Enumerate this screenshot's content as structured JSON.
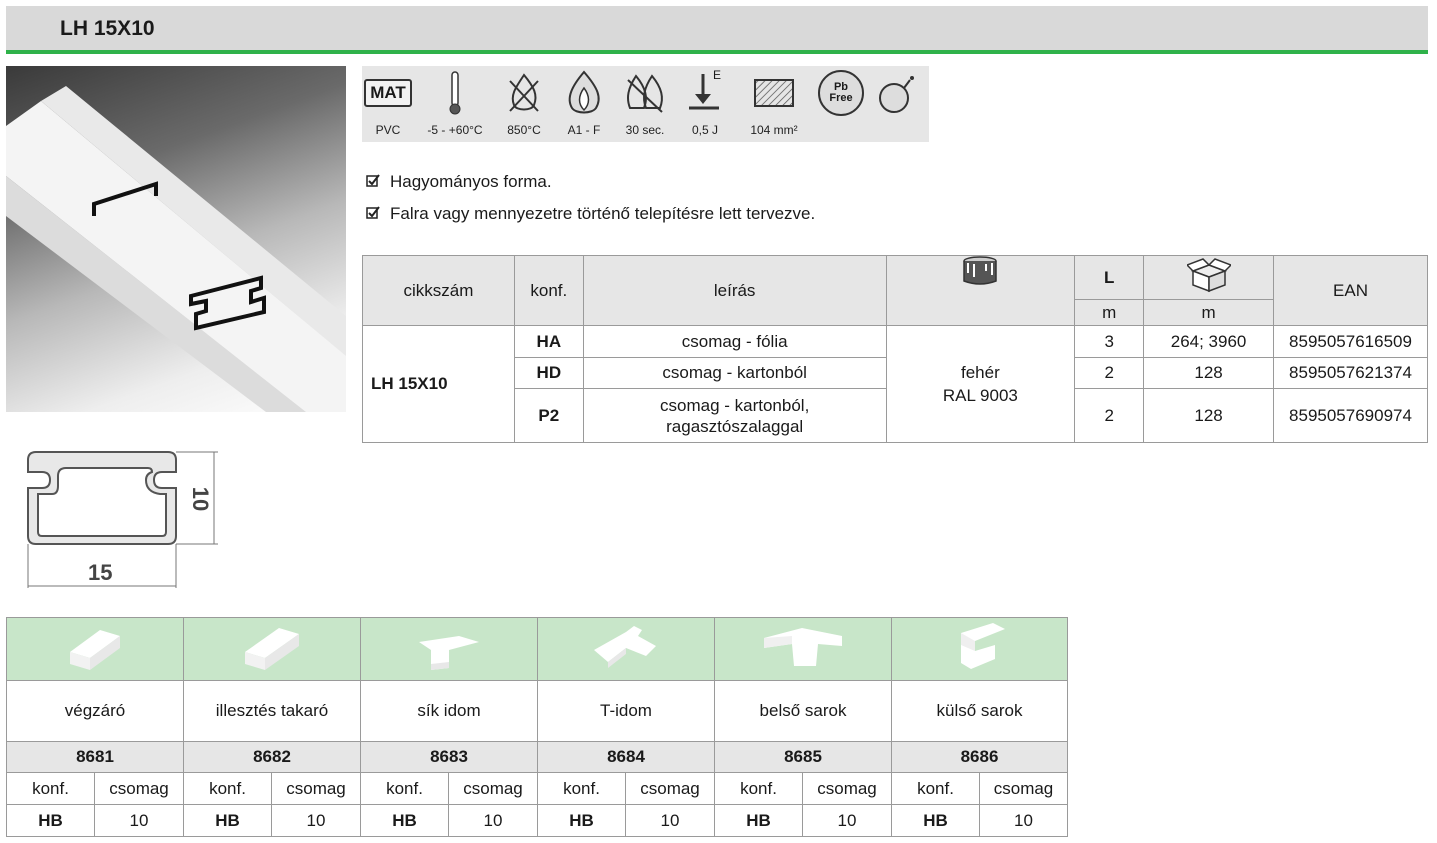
{
  "header": {
    "title": "LH 15X10"
  },
  "profile_drawing": {
    "width_label": "15",
    "height_label": "10"
  },
  "icons": [
    {
      "icon": "mat-box-icon",
      "label": "PVC",
      "badge": "MAT"
    },
    {
      "icon": "thermometer-icon",
      "label": "-5 - +60°C"
    },
    {
      "icon": "crossed-flame-icon",
      "label": "850°C"
    },
    {
      "icon": "flame-icon",
      "label": "A1 - F"
    },
    {
      "icon": "double-flame-icon",
      "label": "30 sec."
    },
    {
      "icon": "impact-arrow-icon",
      "label": "0,5 J",
      "badge": "E"
    },
    {
      "icon": "cross-section-icon",
      "label": "104 mm²"
    },
    {
      "icon": "pb-free-icon",
      "label": "",
      "badge_top": "Pb",
      "badge_bottom": "Free"
    },
    {
      "icon": "bomb-icon",
      "label": ""
    }
  ],
  "features": [
    "Hagyományos forma.",
    "Falra vagy mennyezetre történő telepítésre lett tervezve."
  ],
  "spec_table": {
    "headers": {
      "code": "cikkszám",
      "conf": "konf.",
      "desc": "leírás",
      "color_icon": "paint-bucket-icon",
      "length": "L",
      "length_unit": "m",
      "package_icon": "box-icon",
      "package_unit": "m",
      "ean": "EAN"
    },
    "product": "LH 15X10",
    "color": {
      "line1": "fehér",
      "line2": "RAL 9003"
    },
    "rows": [
      {
        "conf": "HA",
        "desc": "csomag - fólia",
        "desc2": "",
        "length": "3",
        "package": "264; 3960",
        "ean": "8595057616509"
      },
      {
        "conf": "HD",
        "desc": "csomag - kartonból",
        "desc2": "",
        "length": "2",
        "package": "128",
        "ean": "8595057621374"
      },
      {
        "conf": "P2",
        "desc": "csomag - kartonból,",
        "desc2": "ragasztószalaggal",
        "length": "2",
        "package": "128",
        "ean": "8595057690974"
      }
    ]
  },
  "accessories": {
    "sub_headers": {
      "conf": "konf.",
      "pack": "csomag"
    },
    "items": [
      {
        "name": "végzáró",
        "code": "8681",
        "conf": "HB",
        "pack": "10",
        "icon": "end-cap-icon"
      },
      {
        "name": "illesztés takaró",
        "code": "8682",
        "conf": "HB",
        "pack": "10",
        "icon": "joint-cover-icon"
      },
      {
        "name": "sík idom",
        "code": "8683",
        "conf": "HB",
        "pack": "10",
        "icon": "flat-angle-icon"
      },
      {
        "name": "T-idom",
        "code": "8684",
        "conf": "HB",
        "pack": "10",
        "icon": "t-piece-icon"
      },
      {
        "name": "belső sarok",
        "code": "8685",
        "conf": "HB",
        "pack": "10",
        "icon": "inner-corner-icon"
      },
      {
        "name": "külső sarok",
        "code": "8686",
        "conf": "HB",
        "pack": "10",
        "icon": "outer-corner-icon"
      }
    ]
  },
  "colors": {
    "accent_green": "#2fb24a",
    "light_green": "#c8e6c9",
    "header_gray": "#d9d9d9"
  }
}
